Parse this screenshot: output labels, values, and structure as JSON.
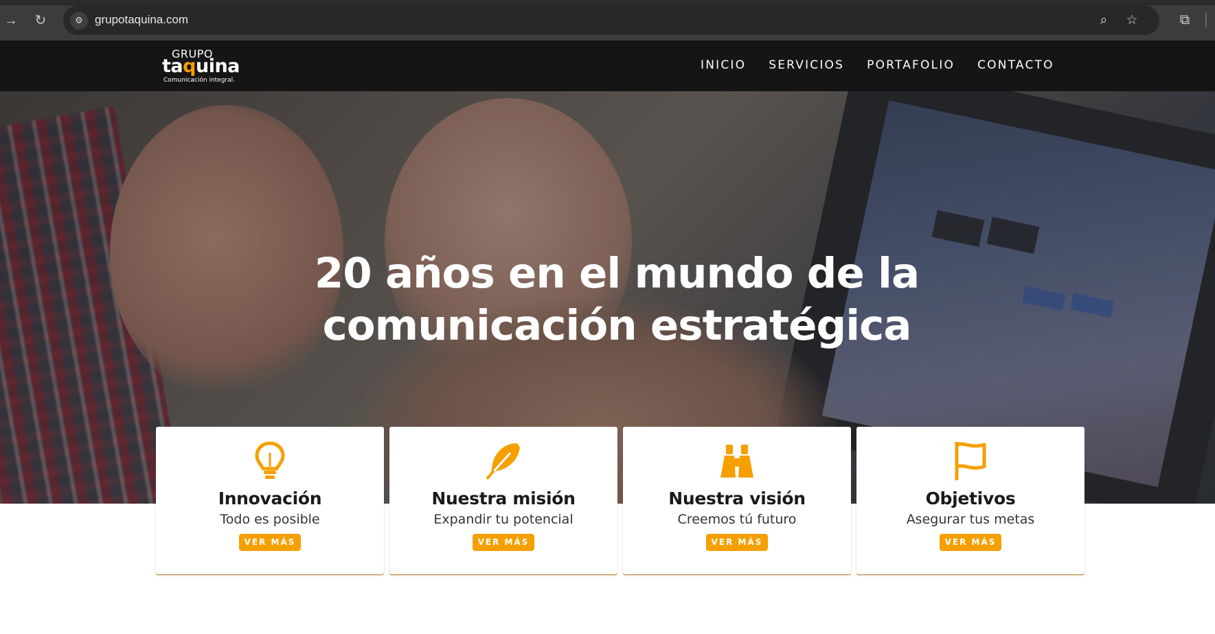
{
  "browser": {
    "url": "grupotaquina.com",
    "icons": [
      "forward-icon",
      "reload-icon",
      "site-info-icon",
      "zoom-icon",
      "bookmark-star-icon",
      "extensions-icon"
    ]
  },
  "header": {
    "logo": {
      "top": "GRUPO",
      "brand_prefix": "ta",
      "brand_accent": "q",
      "brand_suffix": "uina",
      "tagline": "Comunicación integral."
    },
    "nav": [
      "INICIO",
      "SERVICIOS",
      "PORTAFOLIO",
      "CONTACTO"
    ]
  },
  "hero": {
    "line1": "20 años en el mundo de la",
    "line2": "comunicación estratégica"
  },
  "cards": [
    {
      "icon": "lightbulb-icon",
      "title": "Innovación",
      "subtitle": "Todo es posible",
      "button": "VER MÁS"
    },
    {
      "icon": "feather-icon",
      "title": "Nuestra misión",
      "subtitle": "Expandir tu potencial",
      "button": "VER MÁS"
    },
    {
      "icon": "binoculars-icon",
      "title": "Nuestra visión",
      "subtitle": "Creemos tú futuro",
      "button": "VER MÁS"
    },
    {
      "icon": "flag-icon",
      "title": "Objetivos",
      "subtitle": "Asegurar tus metas",
      "button": "VER MÁS"
    }
  ],
  "colors": {
    "accent": "#f5a000",
    "header_bg": "#151515",
    "browser_bg": "#3c3c3c"
  }
}
